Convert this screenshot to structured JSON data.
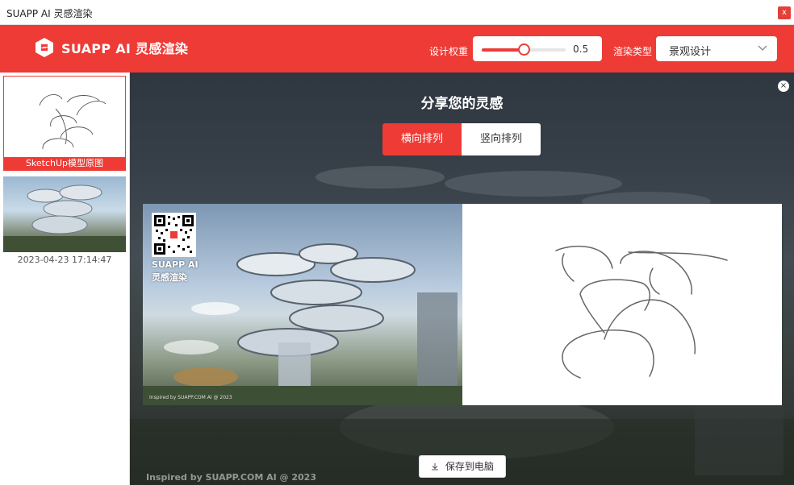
{
  "window": {
    "title": "SUAPP AI 灵感渲染",
    "close_label": "x"
  },
  "header": {
    "brand": "SUAPP AI 灵感渲染",
    "weight_label": "设计权重",
    "weight_value": "0.5",
    "weight_fraction": 0.5,
    "render_type_label": "渲染类型",
    "render_type_value": "景观设计",
    "accent_color": "#ee3b36"
  },
  "sidebar": {
    "items": [
      {
        "caption": "SketchUp模型原图",
        "selected": true
      },
      {
        "timestamp": "2023-04-23 17:14:47",
        "selected": false
      }
    ]
  },
  "share": {
    "title": "分享您的灵感",
    "close_label": "×",
    "layout_options": [
      "横向排列",
      "竖向排列"
    ],
    "active_layout": 0,
    "qr_caption_line1": "SUAPP AI",
    "qr_caption_line2": "灵感渲染",
    "inspired_text": "Inspired by SUAPP.COM AI @ 2023",
    "save_button": "保存到电脑"
  }
}
